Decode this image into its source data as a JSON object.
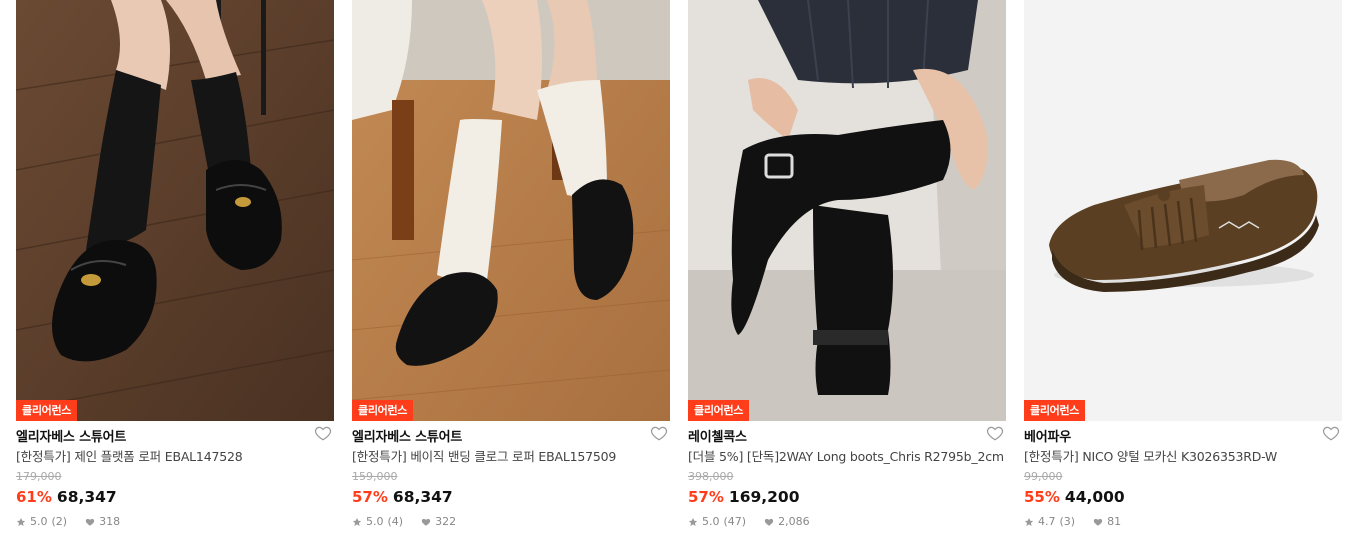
{
  "products": [
    {
      "badge": "클리어런스",
      "brand": "엘리자베스 스튜어트",
      "title": "[한정특가] 제인 플랫폼 로퍼 EBAL147528",
      "original_price": "179,000",
      "discount": "61%",
      "price": "68,347",
      "rating": "5.0",
      "review_count": "(2)",
      "likes": "318",
      "image_icon": "loafer-photo"
    },
    {
      "badge": "클리어런스",
      "brand": "엘리자베스 스튜어트",
      "title": "[한정특가] 베이직 밴딩 클로그 로퍼 EBAL157509",
      "original_price": "159,000",
      "discount": "57%",
      "price": "68,347",
      "rating": "5.0",
      "review_count": "(4)",
      "likes": "322",
      "image_icon": "clog-photo"
    },
    {
      "badge": "클리어런스",
      "brand": "레이첼콕스",
      "title": "[더블 5%] [단독]2WAY Long boots_Chris R2795b_2cm",
      "original_price": "398,000",
      "discount": "57%",
      "price": "169,200",
      "rating": "5.0",
      "review_count": "(47)",
      "likes": "2,086",
      "image_icon": "boots-photo"
    },
    {
      "badge": "클리어런스",
      "brand": "베어파우",
      "title": "[한정특가] NICO 양털 모카신 K3026353RD-W",
      "original_price": "99,000",
      "discount": "55%",
      "price": "44,000",
      "rating": "4.7",
      "review_count": "(3)",
      "likes": "81",
      "image_icon": "moccasin-photo"
    }
  ],
  "colors": {
    "accent": "#ff3d1a",
    "text": "#111111",
    "muted": "#888888"
  }
}
